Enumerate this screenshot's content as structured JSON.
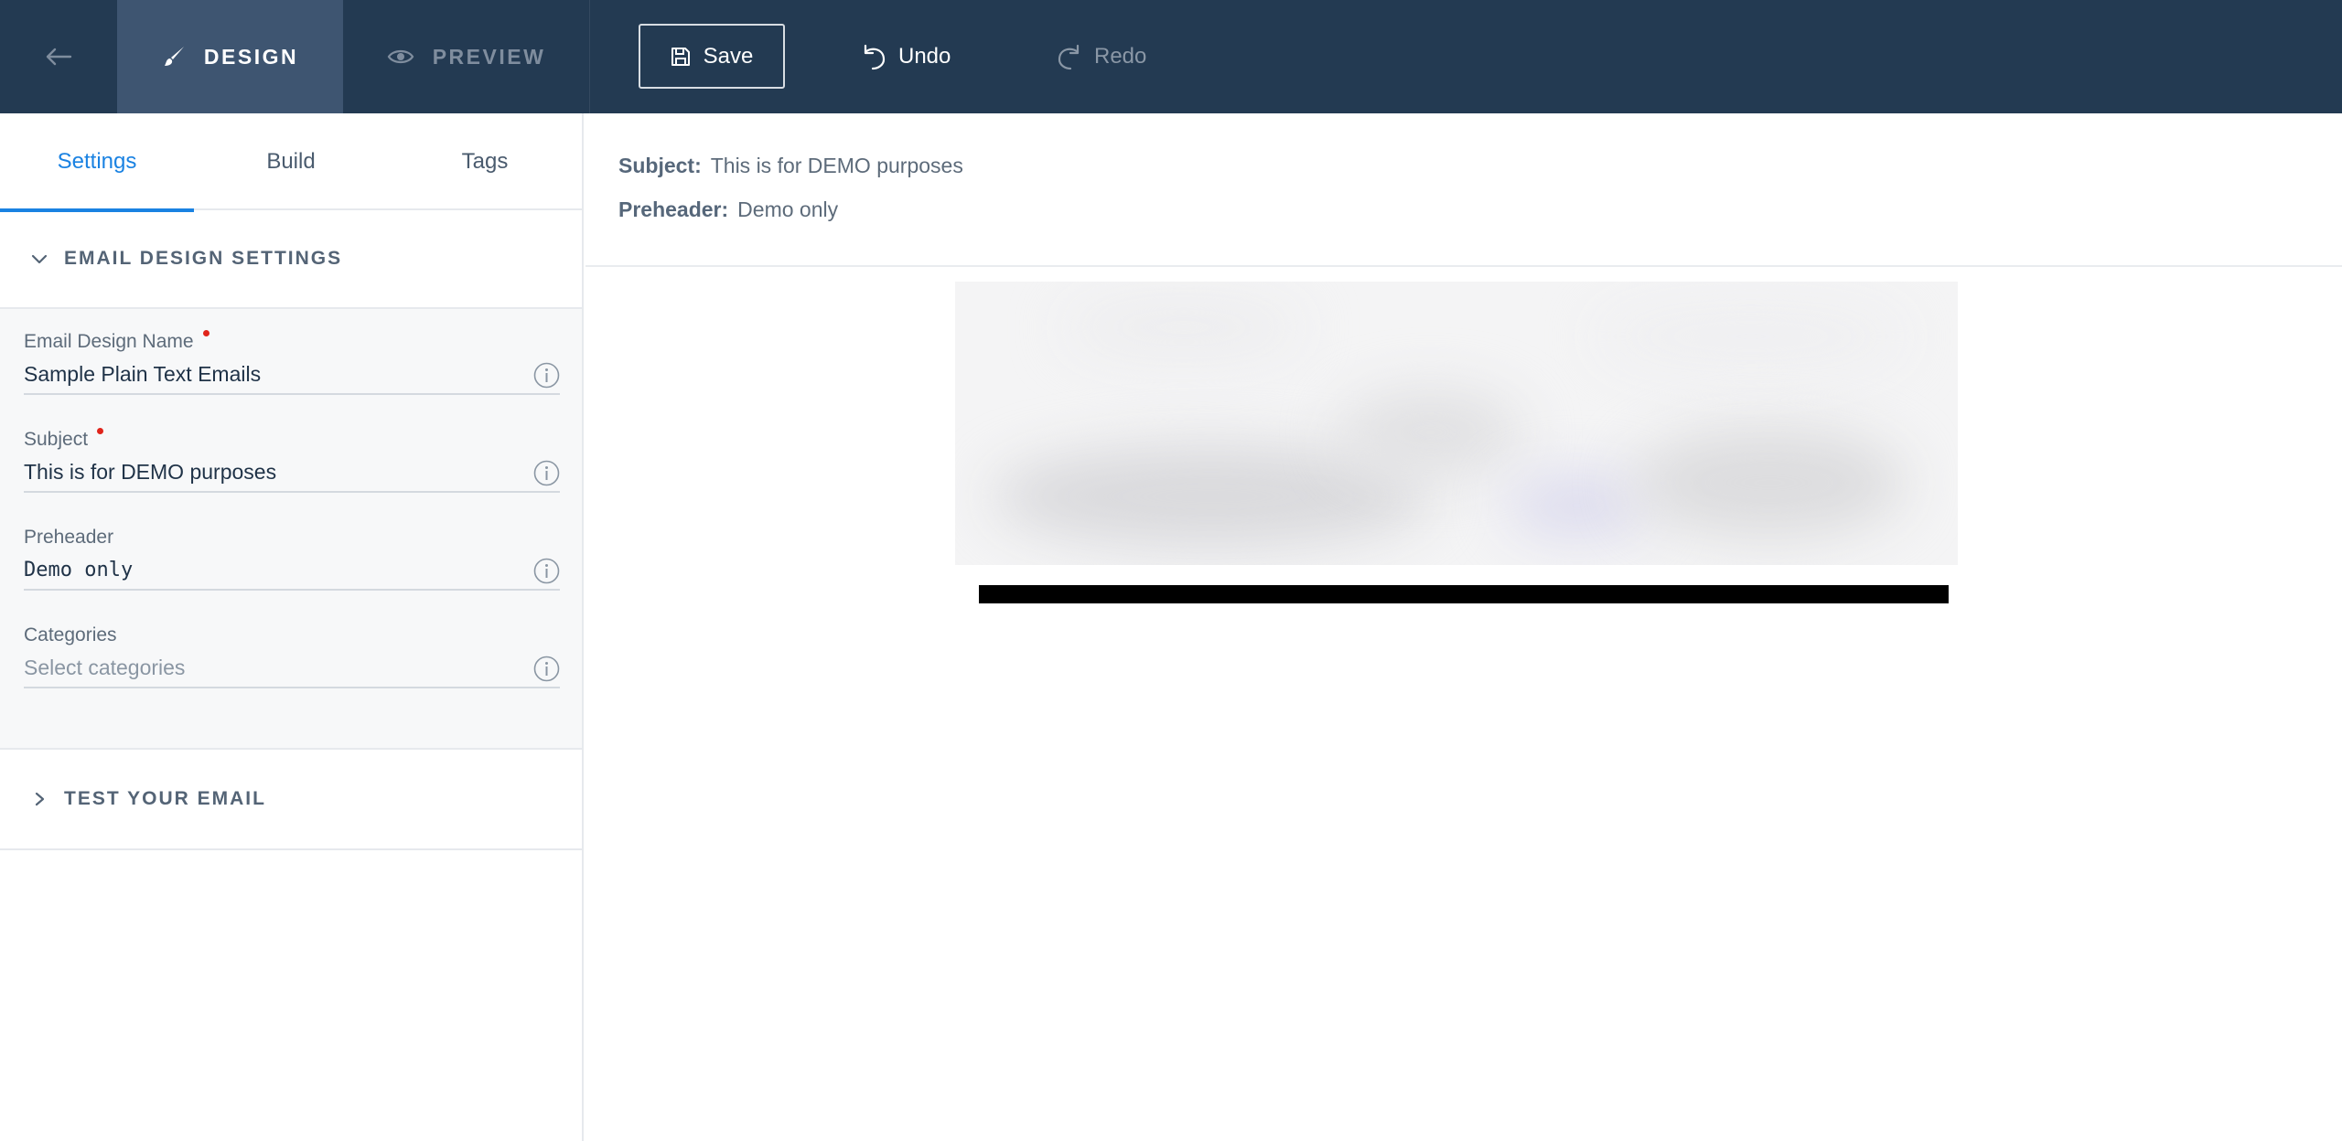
{
  "topbar": {
    "design_label": "DESIGN",
    "preview_label": "PREVIEW",
    "save_label": "Save",
    "undo_label": "Undo",
    "redo_label": "Redo"
  },
  "sidebar": {
    "tabs": [
      {
        "label": "Settings",
        "active": true
      },
      {
        "label": "Build",
        "active": false
      },
      {
        "label": "Tags",
        "active": false
      }
    ],
    "design_settings_title": "EMAIL DESIGN SETTINGS",
    "test_title": "TEST YOUR EMAIL",
    "fields": {
      "design_name": {
        "label": "Email Design Name",
        "required": true,
        "value": "Sample Plain Text Emails"
      },
      "subject": {
        "label": "Subject",
        "required": true,
        "value": "This is for DEMO purposes"
      },
      "preheader": {
        "label": "Preheader",
        "required": false,
        "value": "Demo only"
      },
      "categories": {
        "label": "Categories",
        "required": false,
        "placeholder": "Select categories"
      }
    }
  },
  "preview": {
    "subject_key": "Subject:",
    "subject_value": "This is for DEMO purposes",
    "preheader_key": "Preheader:",
    "preheader_value": "Demo only"
  },
  "colors": {
    "topbar_bg": "#233a52",
    "active_tab_bg": "#3e5571",
    "accent": "#1a82e2",
    "required": "#e0241b"
  }
}
